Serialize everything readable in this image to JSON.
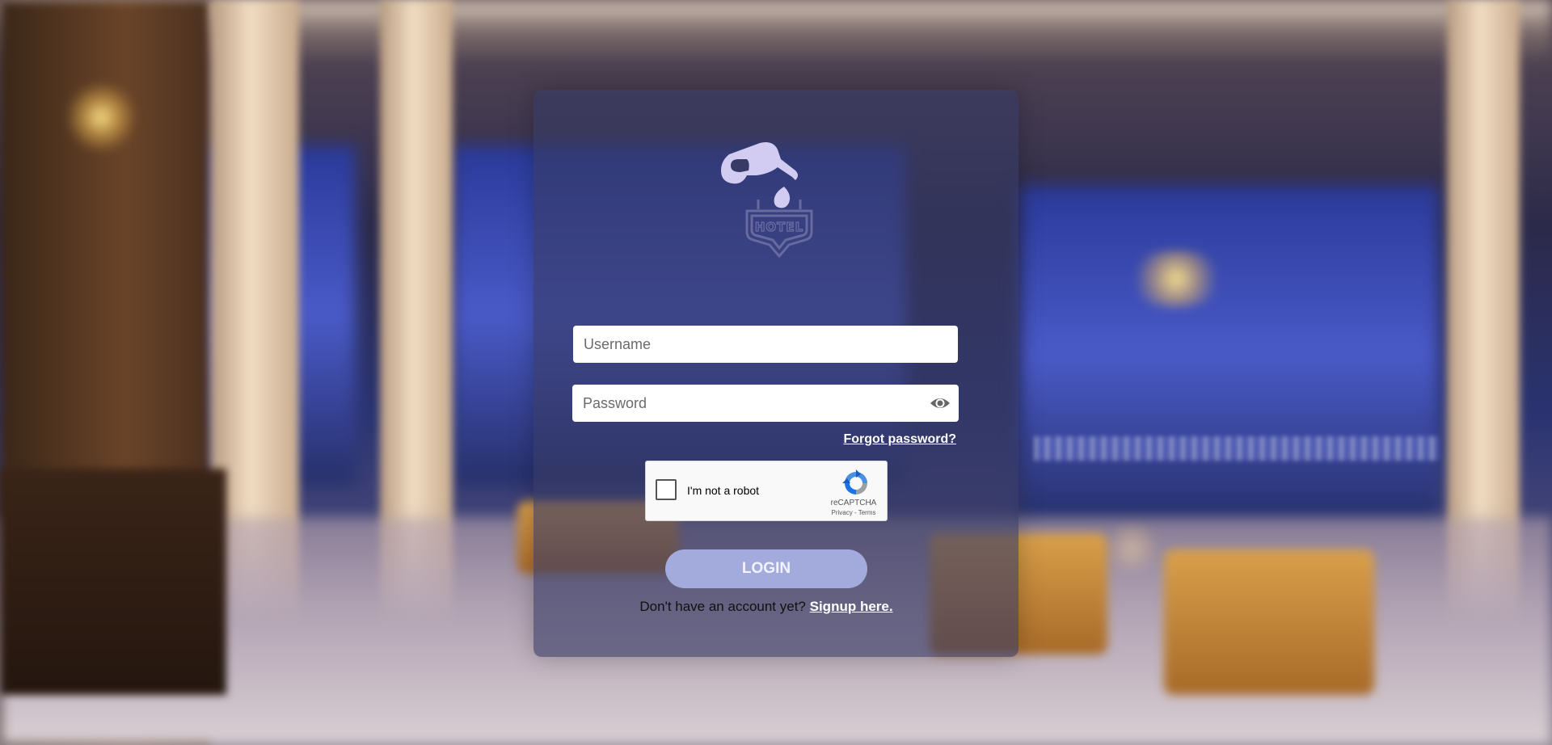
{
  "background": {
    "description_colors": {
      "night_window": "#3a4ab8",
      "wood": "#5a3a22",
      "pillar": "#e8d2b8",
      "lamp": "#ffd87a"
    }
  },
  "logo": {
    "icon": "fuel-nozzle-hotel-sign-icon",
    "sign_text": "HOTEL",
    "color": "#d2ccf2"
  },
  "form": {
    "username_placeholder": "Username",
    "password_placeholder": "Password",
    "forgot_password": "Forgot password?",
    "captcha": {
      "label": "I'm not a robot",
      "brand": "reCAPTCHA",
      "links": "Privacy - Terms"
    },
    "login_label": "LOGIN",
    "signup_prompt": "Don't have an account yet?",
    "signup_link": "Signup here."
  },
  "colors": {
    "card": "#373a64",
    "login_button": "#a3abdd",
    "link": "#ffffff"
  }
}
